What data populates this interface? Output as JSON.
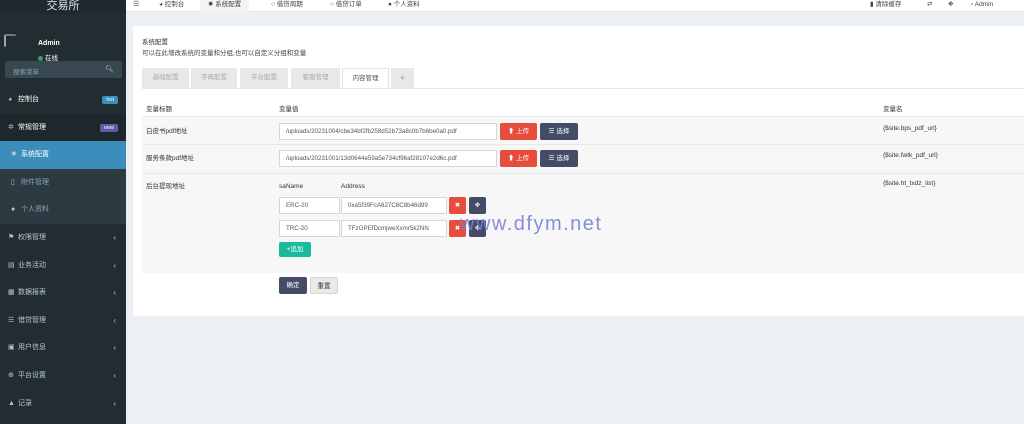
{
  "app": {
    "title": "交易所"
  },
  "user": {
    "name": "Admin",
    "status": "在线"
  },
  "search": {
    "placeholder": "搜索菜单"
  },
  "menu": [
    {
      "icon": "dashboard",
      "label": "控制台",
      "badge": "hot"
    },
    {
      "icon": "cogs",
      "label": "常规管理",
      "badge": "new"
    },
    {
      "icon": "cog",
      "label": "系统配置"
    },
    {
      "icon": "file",
      "label": "附件管理"
    },
    {
      "icon": "user",
      "label": "个人资料"
    },
    {
      "icon": "group",
      "label": "权限管理"
    },
    {
      "icon": "chart",
      "label": "业务活动"
    },
    {
      "icon": "report",
      "label": "数据报表"
    },
    {
      "icon": "list",
      "label": "借贷管理"
    },
    {
      "icon": "user-card",
      "label": "用户信息"
    },
    {
      "icon": "globe",
      "label": "平台设置"
    },
    {
      "icon": "picture",
      "label": "记录"
    }
  ],
  "topbar": {
    "menu_icon": "☰",
    "tabs": [
      "控制台",
      "系统配置",
      "借贷周期",
      "借贷订单",
      "个人资料"
    ],
    "clear_cache": "清除缓存",
    "admin": "Admin"
  },
  "page": {
    "title": "系统配置",
    "subtitle": "可以在此增改系统的变量和分组,也可以自定义分组和变量",
    "tabs": [
      "基础配置",
      "字典配置",
      "平台配置",
      "客服管理",
      "内容管理"
    ],
    "active_tab": "内容管理",
    "headers": {
      "title": "变量标题",
      "value": "变量值",
      "name": "变量名"
    }
  },
  "rows": [
    {
      "title": "白皮书pdf地址",
      "value": "/uploads/20231004/cbe34bf2fb258d52b73a8c0b7b6be0a0.pdf",
      "name": "{$site.bps_pdf_url}"
    },
    {
      "title": "服务条款pdf地址",
      "value": "/uploads/20231001/13d0644e59a5e734cf96af28107e2d6c.pdf",
      "name": "{$site.fwtk_pdf_url}"
    },
    {
      "title": "后台提现地址",
      "name": "{$site.ht_txdz_list}"
    }
  ],
  "withdraw": {
    "col_name": "saName",
    "col_address": "Address",
    "items": [
      {
        "name": "ERC-20",
        "address": "0xa5f39FcA627C8C8b46d99"
      },
      {
        "name": "TRC-20",
        "address": "TFzGPEfDcmjweXxmr5k2NN"
      }
    ],
    "add_label": "追加"
  },
  "buttons": {
    "upload": "上传",
    "select": "选择",
    "confirm": "确定",
    "reset": "重置"
  },
  "watermark": "www.dfym.net",
  "colors": {
    "sidebar": "#222d32",
    "active": "#3c8dbc",
    "danger": "#e74c3c",
    "dark_button": "#444c67",
    "success": "#18bc9c"
  }
}
